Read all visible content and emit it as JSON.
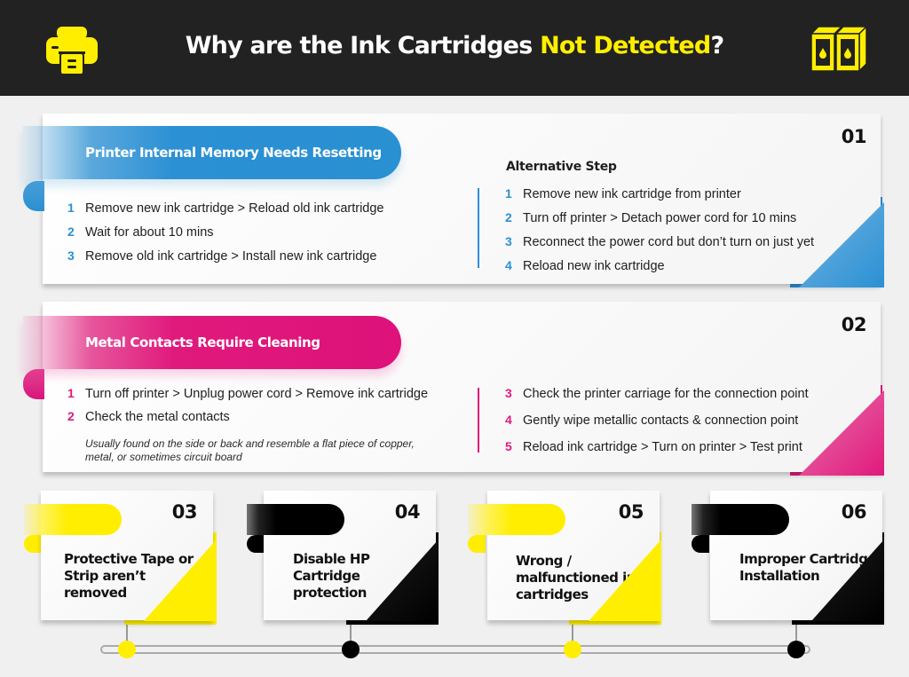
{
  "header": {
    "title_prefix": "Why are the Ink Cartridges ",
    "title_accent": "Not Detected",
    "title_suffix": "?",
    "left_icon": "printer-icon",
    "right_icon": "ink-cartridges-icon"
  },
  "colors": {
    "header_bg": "#222222",
    "accent_yellow": "#ffee00",
    "blue": "#2b90d4",
    "pink": "#e0197c",
    "black": "#000000",
    "page_bg": "#f0f0f0"
  },
  "sections": [
    {
      "number": "01",
      "title": "Printer Internal Memory Needs Resetting",
      "color": "blue",
      "steps": [
        {
          "num": "1",
          "text": "Remove new ink cartridge > Reload old ink cartridge"
        },
        {
          "num": "2",
          "text": "Wait for about 10 mins"
        },
        {
          "num": "3",
          "text": "Remove old ink cartridge > Install new ink cartridge"
        }
      ],
      "alternative_title": "Alternative Step",
      "alternative_steps": [
        {
          "num": "1",
          "text": "Remove new ink cartridge from printer"
        },
        {
          "num": "2",
          "text": "Turn off printer > Detach power cord for 10 mins"
        },
        {
          "num": "3",
          "text": "Reconnect the power cord but don’t turn on just yet"
        },
        {
          "num": "4",
          "text": "Reload new ink cartridge"
        }
      ]
    },
    {
      "number": "02",
      "title": "Metal Contacts Require Cleaning",
      "color": "pink",
      "steps": [
        {
          "num": "1",
          "text": "Turn off printer > Unplug power cord > Remove ink cartridge"
        },
        {
          "num": "2",
          "text": "Check the metal contacts",
          "note": "Usually found on the side or back and resemble a flat piece of copper, metal, or sometimes circuit board"
        }
      ],
      "right_steps": [
        {
          "num": "3",
          "text": "Check the printer carriage for the connection point"
        },
        {
          "num": "4",
          "text": "Gently wipe metallic contacts & connection point"
        },
        {
          "num": "5",
          "text": "Reload ink cartridge > Turn on printer > Test print"
        }
      ]
    }
  ],
  "small_cards": [
    {
      "number": "03",
      "title": "Protective Tape or Strip aren’t removed",
      "color": "yellow"
    },
    {
      "number": "04",
      "title": "Disable HP Cartridge protection",
      "color": "black"
    },
    {
      "number": "05",
      "title": "Wrong / malfunctioned ink cartridges",
      "color": "yellow"
    },
    {
      "number": "06",
      "title": "Improper Cartridge Installation",
      "color": "black"
    }
  ]
}
